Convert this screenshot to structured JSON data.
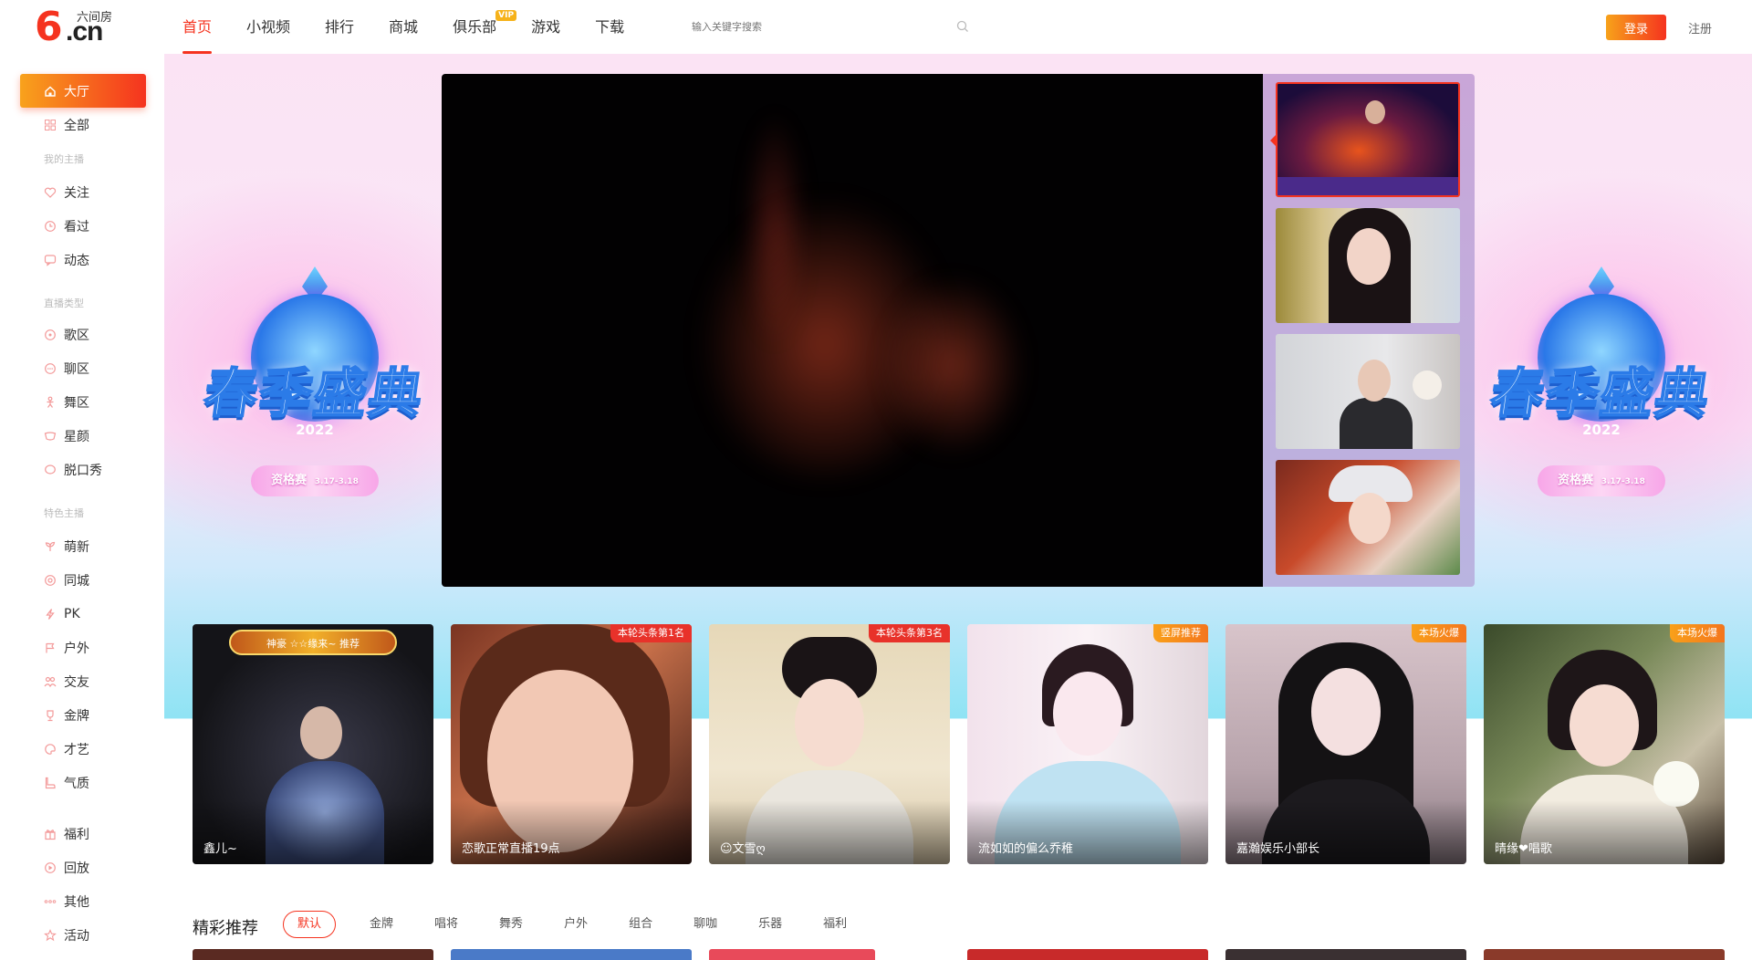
{
  "header": {
    "logo_brand": "六间房",
    "logo_six": "6",
    "logo_domain": ".cn",
    "nav": [
      "首页",
      "小视频",
      "排行",
      "商城",
      "俱乐部",
      "游戏",
      "下载"
    ],
    "vip_badge": "VIP",
    "search_placeholder": "输入关键字搜索",
    "login": "登录",
    "register": "注册"
  },
  "sidebar": {
    "hall": "大厅",
    "all": "全部",
    "group_my": "我的主播",
    "follow": "关注",
    "watched": "看过",
    "dynamic": "动态",
    "group_type": "直播类型",
    "song": "歌区",
    "chat": "聊区",
    "dance": "舞区",
    "star": "星颜",
    "talkshow": "脱口秀",
    "group_special": "特色主播",
    "newbie": "萌新",
    "local": "同城",
    "pk": "PK",
    "outdoor": "户外",
    "friends": "交友",
    "gold": "金牌",
    "talent": "才艺",
    "temperament": "气质",
    "welfare": "福利",
    "replay": "回放",
    "other": "其他",
    "activity": "活动"
  },
  "hero": {
    "badge_title": "春季盛典",
    "badge_year": "2022",
    "badge_pill": "资格赛",
    "badge_date": "3.17-3.18",
    "accent": "#f5331f"
  },
  "cards": [
    {
      "name": "鑫儿~",
      "tag": "",
      "crown": "神豪 ☆☆缘来~ 推荐"
    },
    {
      "name": "恋歌正常直播19点",
      "tag": "本轮头条第1名"
    },
    {
      "name": "☺文雪ღ",
      "tag": "本轮头条第3名"
    },
    {
      "name": "流如如的偏么乔稚",
      "tag": "竖屏推荐"
    },
    {
      "name": "嘉瀚娱乐小部长",
      "tag": "本场火爆"
    },
    {
      "name": "晴缘❤唱歌",
      "tag": "本场火爆"
    }
  ],
  "recommend": {
    "title": "精彩推荐",
    "tabs": [
      "默认",
      "金牌",
      "唱将",
      "舞秀",
      "户外",
      "组合",
      "聊咖",
      "乐器",
      "福利"
    ]
  }
}
